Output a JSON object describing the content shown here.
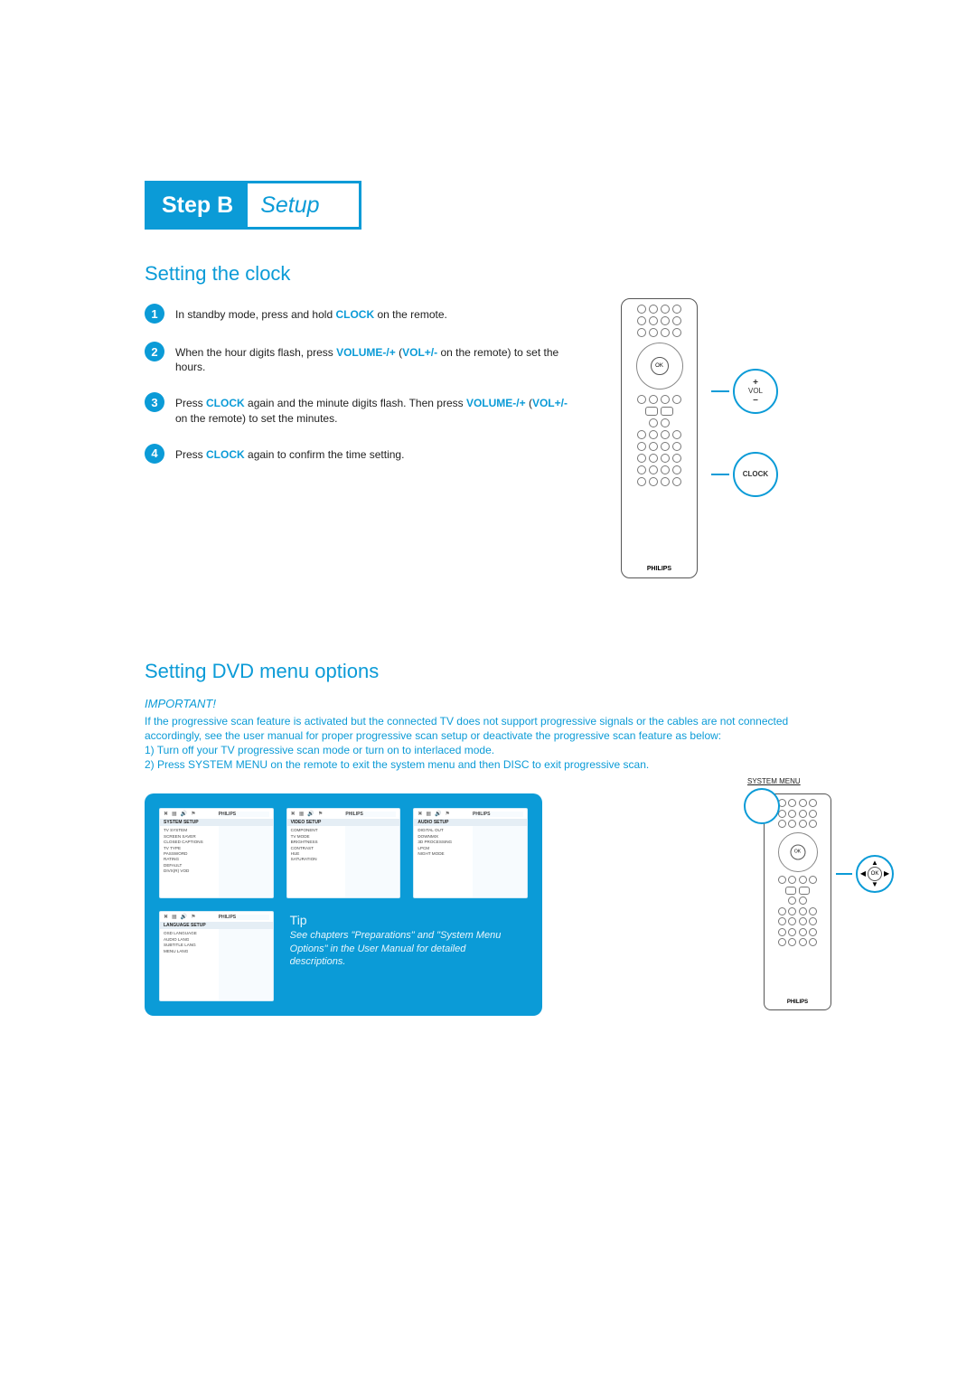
{
  "header": {
    "step": "Step B",
    "setup": "Setup"
  },
  "brand": "PHILIPS",
  "clock": {
    "title": "Setting the clock",
    "steps": [
      {
        "pre": "In standby mode, press and hold ",
        "kw1": "CLOCK",
        "post": " on the remote."
      },
      {
        "pre": "When the hour digits flash, press ",
        "kw1": "VOLUME-/+",
        "mid": " (",
        "kw2": "VOL+/-",
        "post": " on the remote) to set the hours."
      },
      {
        "pre": "Press ",
        "kw1": "CLOCK",
        "mid": " again and the minute digits flash. Then press ",
        "kw2": "VOLUME-/+",
        "mid2": " (",
        "kw3": "VOL+/-",
        "post": " on the remote) to set the minutes."
      },
      {
        "pre": "Press ",
        "kw1": "CLOCK",
        "post": " again to confirm the time setting."
      }
    ],
    "callouts": {
      "vol": "VOL",
      "plus": "+",
      "minus": "–",
      "clock": "CLOCK"
    },
    "ok": "OK"
  },
  "dvd": {
    "title": "Setting DVD menu options",
    "important_label": "IMPORTANT!",
    "warn1": "If the progressive scan feature is activated but the connected TV does not support progressive signals or the cables are not connected accordingly, see the user manual for proper progressive scan setup or deactivate the progressive scan feature as below:",
    "warn2": "1) Turn off your TV progressive scan mode or turn on to interlaced mode.",
    "warn3": "2) Press SYSTEM MENU on the remote to exit the system menu and then DISC to exit progressive scan.",
    "screens": {
      "system": {
        "title": "SYSTEM SETUP",
        "items": [
          "TV SYSTEM",
          "SCREEN SAVER",
          "CLOSED CAPTIONS",
          "TV TYPE",
          "PASSWORD",
          "RATING",
          "DEFAULT",
          "DIVX(R) VOD"
        ]
      },
      "video": {
        "title": "VIDEO SETUP",
        "items": [
          "COMPONENT",
          "TV MODE",
          "BRIGHTNESS",
          "CONTRAST",
          "HUE",
          "SATURATION"
        ]
      },
      "audio": {
        "title": "AUDIO SETUP",
        "items": [
          "DIGITAL OUT",
          "DOWNMIX",
          "3D PROCESSING",
          "LPCM",
          "NIGHT MODE"
        ]
      },
      "language": {
        "title": "LANGUAGE SETUP",
        "items": [
          "OSD LANGUAGE",
          "AUDIO LANG",
          "SUBTITLE LANG",
          "MENU LANG"
        ]
      }
    },
    "tip": {
      "title": "Tip",
      "text": "See chapters \"Preparations\" and \"System Menu Options\" in the User Manual for detailed descriptions."
    },
    "remote": {
      "system_menu": "SYSTEM MENU",
      "ok": "OK"
    }
  }
}
